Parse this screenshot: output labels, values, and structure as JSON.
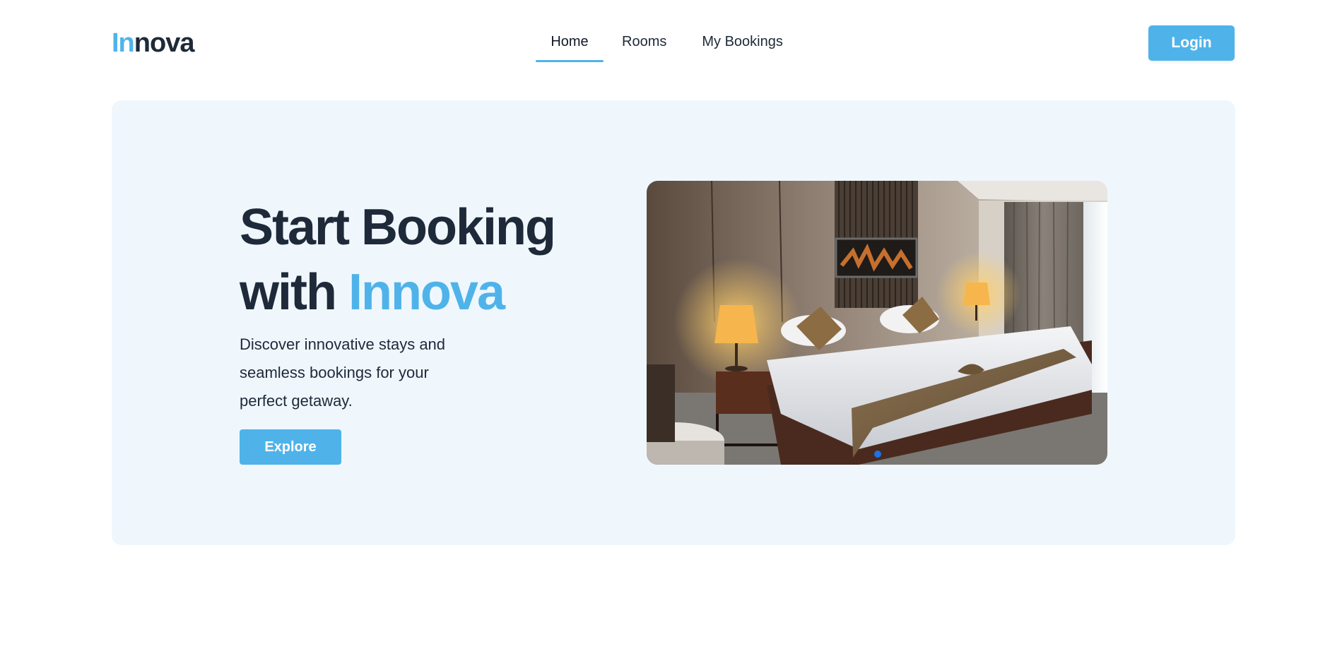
{
  "brand": {
    "logo_accent": "In",
    "logo_rest": "nova"
  },
  "nav": {
    "items": [
      {
        "label": "Home",
        "active": true
      },
      {
        "label": "Rooms",
        "active": false
      },
      {
        "label": "My Bookings",
        "active": false
      }
    ]
  },
  "header": {
    "login_label": "Login"
  },
  "hero": {
    "headline_line1": "Start Booking",
    "headline_line2_prefix": "with ",
    "headline_line2_accent": "Innova",
    "subtitle": "Discover innovative stays and seamless bookings for your perfect getaway.",
    "explore_label": "Explore",
    "carousel": {
      "slide_count": 1,
      "active_slide": 1,
      "image_subject": "hotel bedroom with double bed and lamps"
    }
  },
  "colors": {
    "accent": "#4fb3ea",
    "text_dark": "#1e2939",
    "hero_background": "#eff7fd",
    "carousel_dot": "#1a73e8"
  }
}
